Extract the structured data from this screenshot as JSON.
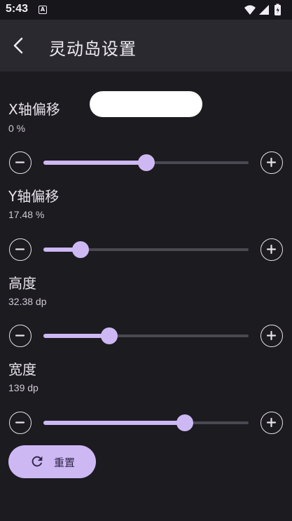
{
  "status_bar": {
    "time": "5:43",
    "app_icon_letter": "A"
  },
  "app_bar": {
    "title": "灵动岛设置",
    "back_icon": "arrow-back-icon"
  },
  "controls": [
    {
      "id": "x",
      "label": "X轴偏移",
      "value_text": "0 %",
      "slider_fraction": 0.5
    },
    {
      "id": "y",
      "label": "Y轴偏移",
      "value_text": "17.48 %",
      "slider_fraction": 0.18
    },
    {
      "id": "height",
      "label": "高度",
      "value_text": "32.38 dp",
      "slider_fraction": 0.32
    },
    {
      "id": "width",
      "label": "宽度",
      "value_text": "139 dp",
      "slider_fraction": 0.69
    }
  ],
  "text_field": {
    "value": "",
    "placeholder": ""
  },
  "reset_button": {
    "label": "重置",
    "icon": "refresh-icon"
  },
  "colors": {
    "accent": "#cdb8f4",
    "background": "#1c1b20",
    "app_bar": "#2a2930",
    "track": "#4a4850"
  }
}
